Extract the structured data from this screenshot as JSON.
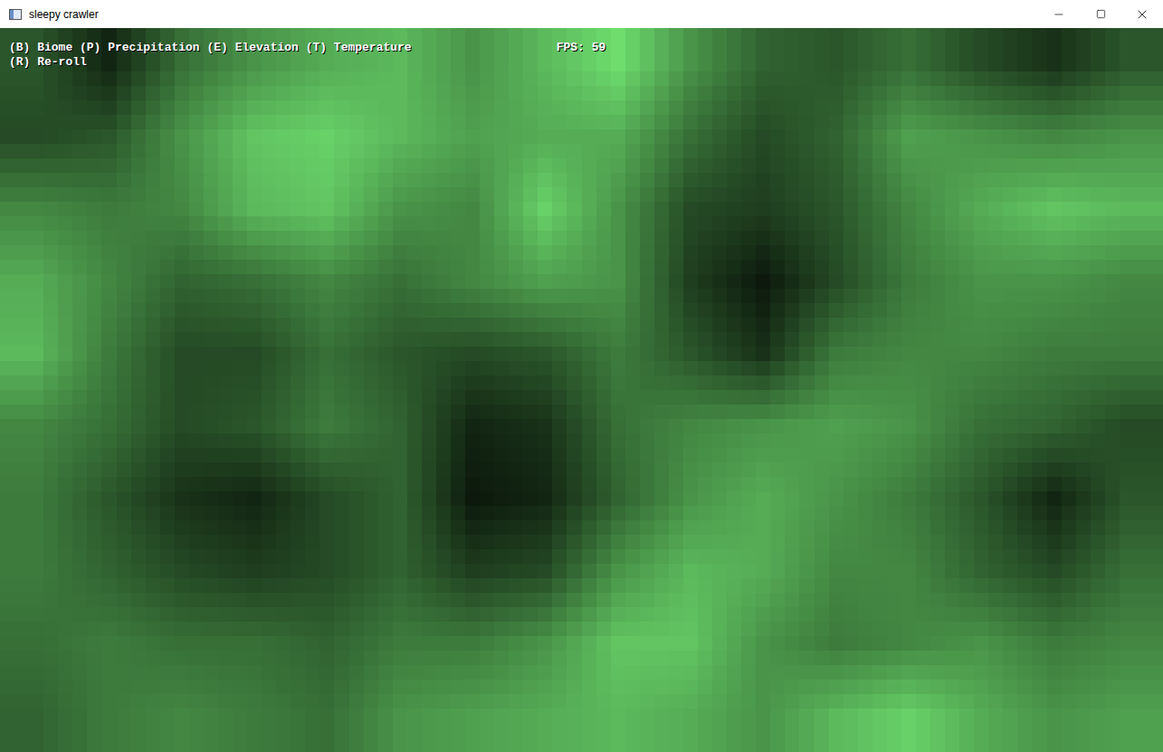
{
  "window": {
    "title": "sleepy crawler"
  },
  "hud": {
    "controls": [
      "(B) Biome (P) Precipitation (E) Elevation (T) Temperature",
      "(R) Re-roll"
    ],
    "fps": "FPS: 59"
  },
  "map": {
    "mode": "Elevation",
    "levels": [
      [
        0.35,
        0.15,
        0.45,
        0.6,
        0.7,
        0.75,
        0.6,
        0.75,
        0.9,
        0.6,
        0.4,
        0.35,
        0.45,
        0.3,
        0.2,
        0.35
      ],
      [
        0.3,
        0.35,
        0.6,
        0.8,
        0.85,
        0.75,
        0.65,
        0.7,
        0.7,
        0.45,
        0.3,
        0.4,
        0.65,
        0.6,
        0.55,
        0.6
      ],
      [
        0.55,
        0.5,
        0.55,
        0.75,
        0.8,
        0.6,
        0.55,
        0.85,
        0.6,
        0.3,
        0.25,
        0.35,
        0.55,
        0.7,
        0.8,
        0.75
      ],
      [
        0.7,
        0.55,
        0.4,
        0.45,
        0.55,
        0.45,
        0.55,
        0.65,
        0.6,
        0.25,
        0.1,
        0.3,
        0.5,
        0.6,
        0.6,
        0.55
      ],
      [
        0.75,
        0.5,
        0.3,
        0.3,
        0.45,
        0.35,
        0.3,
        0.35,
        0.5,
        0.35,
        0.2,
        0.5,
        0.55,
        0.55,
        0.5,
        0.5
      ],
      [
        0.55,
        0.45,
        0.3,
        0.35,
        0.5,
        0.4,
        0.15,
        0.2,
        0.45,
        0.55,
        0.6,
        0.65,
        0.6,
        0.45,
        0.4,
        0.3
      ],
      [
        0.5,
        0.35,
        0.2,
        0.15,
        0.3,
        0.4,
        0.1,
        0.15,
        0.4,
        0.6,
        0.7,
        0.6,
        0.5,
        0.35,
        0.15,
        0.35
      ],
      [
        0.5,
        0.4,
        0.3,
        0.25,
        0.3,
        0.4,
        0.25,
        0.3,
        0.6,
        0.75,
        0.7,
        0.55,
        0.55,
        0.4,
        0.3,
        0.45
      ],
      [
        0.45,
        0.5,
        0.45,
        0.45,
        0.4,
        0.5,
        0.5,
        0.6,
        0.8,
        0.8,
        0.6,
        0.5,
        0.55,
        0.6,
        0.5,
        0.55
      ],
      [
        0.4,
        0.5,
        0.55,
        0.5,
        0.45,
        0.6,
        0.65,
        0.7,
        0.75,
        0.7,
        0.6,
        0.75,
        0.85,
        0.7,
        0.6,
        0.65
      ]
    ]
  }
}
